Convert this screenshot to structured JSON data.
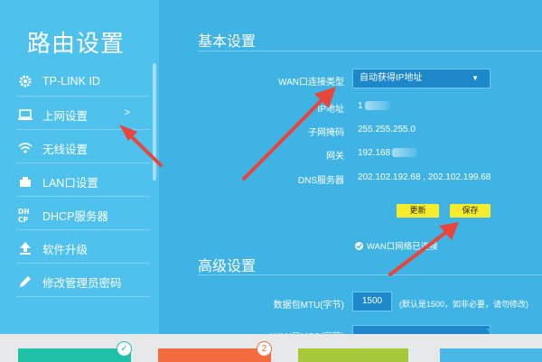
{
  "sidebar": {
    "title": "路由设置",
    "items": [
      {
        "label": "TP-LINK ID",
        "icon": "gear-icon"
      },
      {
        "label": "上网设置",
        "icon": "monitor-icon",
        "chevron": ">"
      },
      {
        "label": "无线设置",
        "icon": "wifi-icon"
      },
      {
        "label": "LAN口设置",
        "icon": "lan-port-icon"
      },
      {
        "label": "DHCP服务器",
        "icon": "dhcp-icon"
      },
      {
        "label": "软件升级",
        "icon": "upload-icon"
      },
      {
        "label": "修改管理员密码",
        "icon": "pencil-icon"
      }
    ]
  },
  "basic": {
    "title": "基本设置",
    "wan_type_label": "WAN口连接类型",
    "wan_type_value": "自动获得IP地址",
    "ip_label": "IP地址",
    "ip_value": "1",
    "mask_label": "子网掩码",
    "mask_value": "255.255.255.0",
    "gateway_label": "网关",
    "gateway_value": "192.168",
    "dns_label": "DNS服务器",
    "dns_value": "202.102.192.68 , 202.102.199.68",
    "renew_label": "更新",
    "save_label": "保存",
    "status_text": "WAN口网络已连接"
  },
  "advanced": {
    "title": "高级设置",
    "mtu_label": "数据包MTU(字节)",
    "mtu_value": "1500",
    "mtu_note": "(默认是1500，如非必要，请勿修改)",
    "next_row_label": "WAN口MSS(字节)"
  },
  "bottom": {
    "badge_check": "✓",
    "badge_count": "2"
  },
  "colors": {
    "sidebar_bg": "#4ec1ec",
    "main_bg": "#3fb3e4",
    "button_yellow": "#f6ec2b",
    "arrow_red": "#e8453c",
    "tile_teal": "#21c1a8",
    "tile_orange": "#f26c3f",
    "tile_green": "#a7c83b",
    "tile_blue": "#4ab8e6"
  }
}
